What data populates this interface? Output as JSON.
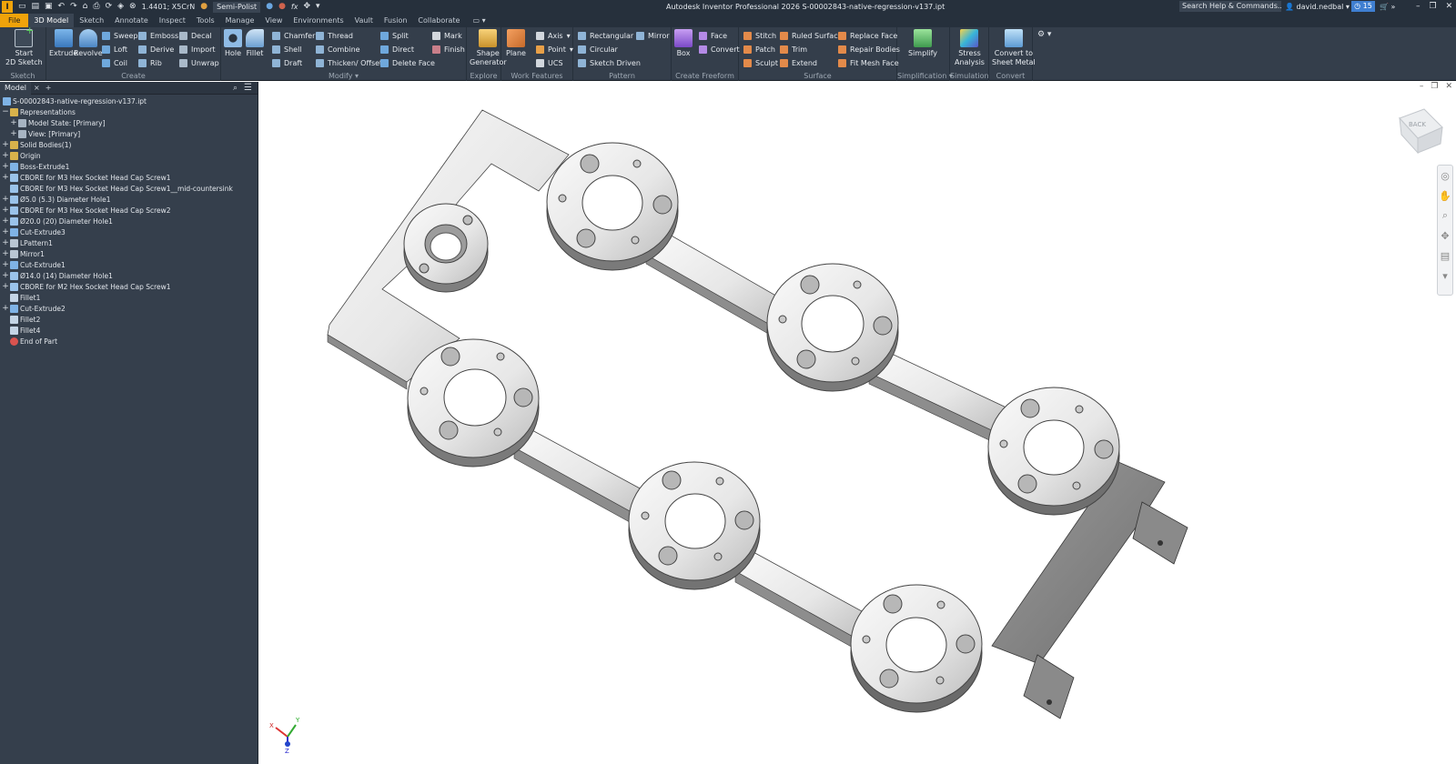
{
  "titlebar": {
    "app_logo": "I",
    "material": "1.4401; X5CrN",
    "appearance": "Semi-Polist",
    "fx": "fx",
    "window_title": "Autodesk Inventor Professional 2026   S-00002843-native-regression-v137.ipt",
    "search_placeholder": "Search Help & Commands...",
    "user": "david.nedbal",
    "clock_count": "15"
  },
  "menu": {
    "file": "File",
    "tabs": [
      "3D Model",
      "Sketch",
      "Annotate",
      "Inspect",
      "Tools",
      "Manage",
      "View",
      "Environments",
      "Vault",
      "Fusion",
      "Collaborate"
    ],
    "active_tab": "3D Model"
  },
  "ribbon": {
    "sketch": {
      "label": "Sketch",
      "start": "Start",
      "start2": "2D Sketch"
    },
    "create": {
      "label": "Create",
      "extrude": "Extrude",
      "revolve": "Revolve",
      "sweep": "Sweep",
      "loft": "Loft",
      "coil": "Coil",
      "emboss": "Emboss",
      "derive": "Derive",
      "rib": "Rib",
      "decal": "Decal",
      "import": "Import",
      "unwrap": "Unwrap"
    },
    "modify": {
      "label": "Modify",
      "hole": "Hole",
      "fillet": "Fillet",
      "chamfer": "Chamfer",
      "shell": "Shell",
      "draft": "Draft",
      "thread": "Thread",
      "combine": "Combine",
      "thicken": "Thicken/ Offset",
      "split": "Split",
      "direct": "Direct",
      "delete_face": "Delete Face",
      "mark": "Mark",
      "finish": "Finish"
    },
    "explore": {
      "label": "Explore",
      "shape1": "Shape",
      "shape2": "Generator"
    },
    "work_features": {
      "label": "Work Features",
      "plane": "Plane",
      "axis": "Axis",
      "point": "Point",
      "ucs": "UCS"
    },
    "pattern": {
      "label": "Pattern",
      "rectangular": "Rectangular",
      "circular": "Circular",
      "sketch_driven": "Sketch Driven",
      "mirror": "Mirror"
    },
    "freeform": {
      "label": "Create Freeform",
      "box": "Box",
      "face": "Face",
      "convert": "Convert"
    },
    "surface": {
      "label": "Surface",
      "stitch": "Stitch",
      "patch": "Patch",
      "sculpt": "Sculpt",
      "ruled": "Ruled Surface",
      "trim": "Trim",
      "extend": "Extend",
      "replace": "Replace Face",
      "repair": "Repair Bodies",
      "fitmesh": "Fit Mesh Face"
    },
    "simplification": {
      "label": "Simplification",
      "simplify": "Simplify"
    },
    "simulation": {
      "label": "Simulation",
      "stress1": "Stress",
      "stress2": "Analysis"
    },
    "convert": {
      "label": "Convert",
      "c1": "Convert to",
      "c2": "Sheet Metal"
    }
  },
  "browser": {
    "tab": "Model",
    "nodes": [
      "S-00002843-native-regression-v137.ipt",
      "Representations",
      "Model State: [Primary]",
      "View: [Primary]",
      "Solid Bodies(1)",
      "Origin",
      "Boss-Extrude1",
      "CBORE for M3 Hex Socket Head Cap Screw1",
      "CBORE for M3 Hex Socket Head Cap Screw1__mid-countersink",
      "Ø5.0 (5.3) Diameter Hole1",
      "CBORE for M3 Hex Socket Head Cap Screw2",
      "Ø20.0 (20) Diameter Hole1",
      "Cut-Extrude3",
      "LPattern1",
      "Mirror1",
      "Cut-Extrude1",
      "Ø14.0 (14) Diameter Hole1",
      "CBORE for M2 Hex Socket Head Cap Screw1",
      "Fillet1",
      "Cut-Extrude2",
      "Fillet2",
      "Fillet4",
      "End of Part"
    ]
  },
  "viewcube": {
    "face": "BACK"
  },
  "triad": {
    "x": "X",
    "y": "Y",
    "z": "Z"
  }
}
